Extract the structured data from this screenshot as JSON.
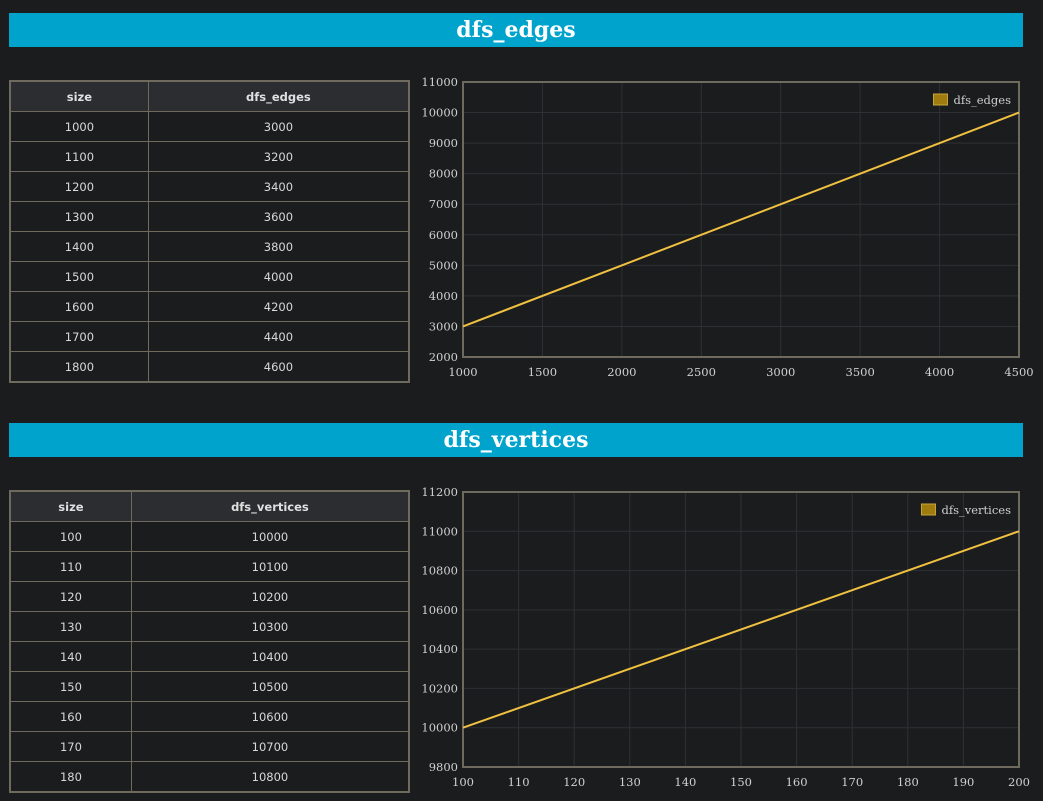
{
  "sections": [
    {
      "title": "dfs_edges",
      "table": {
        "headers": [
          "size",
          "dfs_edges"
        ],
        "rows": [
          [
            "1000",
            "3000"
          ],
          [
            "1100",
            "3200"
          ],
          [
            "1200",
            "3400"
          ],
          [
            "1300",
            "3600"
          ],
          [
            "1400",
            "3800"
          ],
          [
            "1500",
            "4000"
          ],
          [
            "1600",
            "4200"
          ],
          [
            "1700",
            "4400"
          ],
          [
            "1800",
            "4600"
          ]
        ]
      }
    },
    {
      "title": "dfs_vertices",
      "table": {
        "headers": [
          "size",
          "dfs_vertices"
        ],
        "rows": [
          [
            "100",
            "10000"
          ],
          [
            "110",
            "10100"
          ],
          [
            "120",
            "10200"
          ],
          [
            "130",
            "10300"
          ],
          [
            "140",
            "10400"
          ],
          [
            "150",
            "10500"
          ],
          [
            "160",
            "10600"
          ],
          [
            "170",
            "10700"
          ],
          [
            "180",
            "10800"
          ]
        ]
      }
    }
  ],
  "colors": {
    "banner": "#00a3cc",
    "line": "#f0c040",
    "legend_swatch": "#a07c10",
    "grid": "#2e3033",
    "frame": "#6e6a5e"
  },
  "chart_data": [
    {
      "type": "line",
      "series": [
        {
          "name": "dfs_edges",
          "x": [
            1000,
            4500
          ],
          "y": [
            3000,
            10000
          ]
        }
      ],
      "xlim": [
        1000,
        4500
      ],
      "ylim": [
        2000,
        11000
      ],
      "xticks": [
        "1000",
        "1500",
        "2000",
        "2500",
        "3000",
        "3500",
        "4000",
        "4500"
      ],
      "yticks": [
        "2000",
        "3000",
        "4000",
        "5000",
        "6000",
        "7000",
        "8000",
        "9000",
        "10000",
        "11000"
      ],
      "xgrid_count": 7,
      "ygrid_count": 9,
      "grid": true,
      "legend": "top-right"
    },
    {
      "type": "line",
      "series": [
        {
          "name": "dfs_vertices",
          "x": [
            100,
            200
          ],
          "y": [
            10000,
            11000
          ]
        }
      ],
      "xlim": [
        100,
        200
      ],
      "ylim": [
        9800,
        11200
      ],
      "xticks": [
        "100",
        "110",
        "120",
        "130",
        "140",
        "150",
        "160",
        "170",
        "180",
        "190",
        "200"
      ],
      "yticks": [
        "9800",
        "10000",
        "10200",
        "10400",
        "10600",
        "10800",
        "11000",
        "11200"
      ],
      "xgrid_count": 10,
      "ygrid_count": 7,
      "grid": true,
      "legend": "top-right"
    }
  ]
}
